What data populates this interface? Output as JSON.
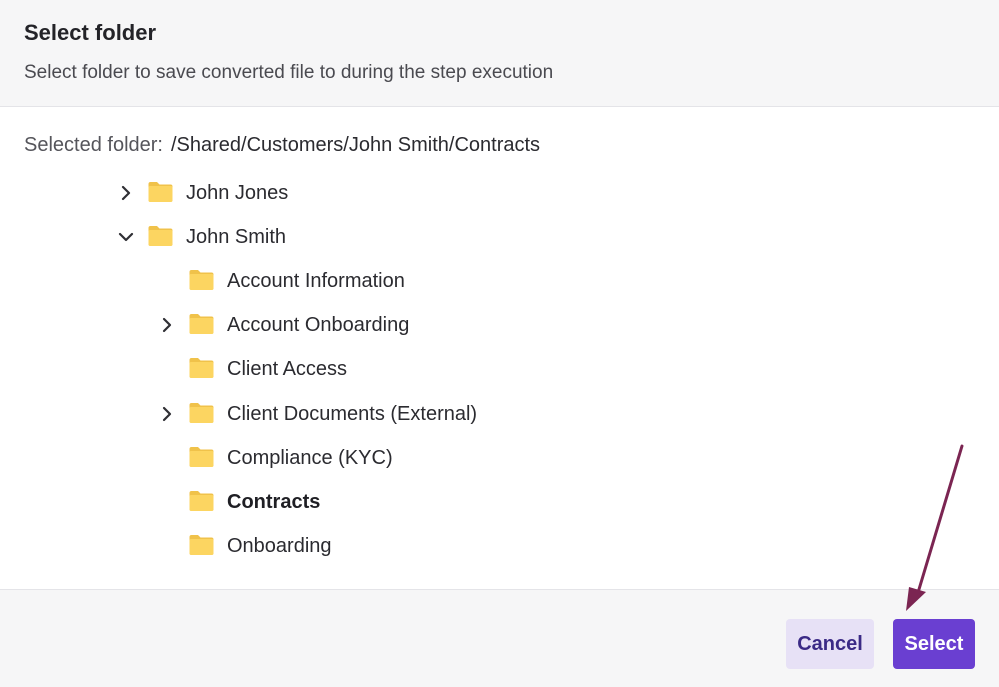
{
  "dialog": {
    "title": "Select folder",
    "subtitle": "Select folder to save converted file to during the step execution"
  },
  "selection": {
    "label": "Selected folder:",
    "path": "/Shared/Customers/John Smith/Contracts"
  },
  "tree": {
    "items": [
      {
        "label": "John Jones",
        "level": 0,
        "expandable": true,
        "expanded": false,
        "selected": false
      },
      {
        "label": "John Smith",
        "level": 0,
        "expandable": true,
        "expanded": true,
        "selected": false
      },
      {
        "label": "Account Information",
        "level": 1,
        "expandable": false,
        "expanded": false,
        "selected": false
      },
      {
        "label": "Account Onboarding",
        "level": 1,
        "expandable": true,
        "expanded": false,
        "selected": false
      },
      {
        "label": "Client Access",
        "level": 1,
        "expandable": false,
        "expanded": false,
        "selected": false
      },
      {
        "label": "Client Documents (External)",
        "level": 1,
        "expandable": true,
        "expanded": false,
        "selected": false
      },
      {
        "label": "Compliance (KYC)",
        "level": 1,
        "expandable": false,
        "expanded": false,
        "selected": false
      },
      {
        "label": "Contracts",
        "level": 1,
        "expandable": false,
        "expanded": false,
        "selected": true
      },
      {
        "label": "Onboarding",
        "level": 1,
        "expandable": false,
        "expanded": false,
        "selected": false
      }
    ]
  },
  "footer": {
    "cancel_label": "Cancel",
    "select_label": "Select"
  },
  "icons": {
    "folder": "folder-icon",
    "collapsed": "chevron-right-icon",
    "expanded": "chevron-down-icon"
  },
  "colors": {
    "folder": "#FCD561",
    "primary": "#6A3FD1",
    "secondary_bg": "#E7E1F6",
    "secondary_text": "#3B2A86",
    "annotation_arrow": "#7B2552"
  }
}
